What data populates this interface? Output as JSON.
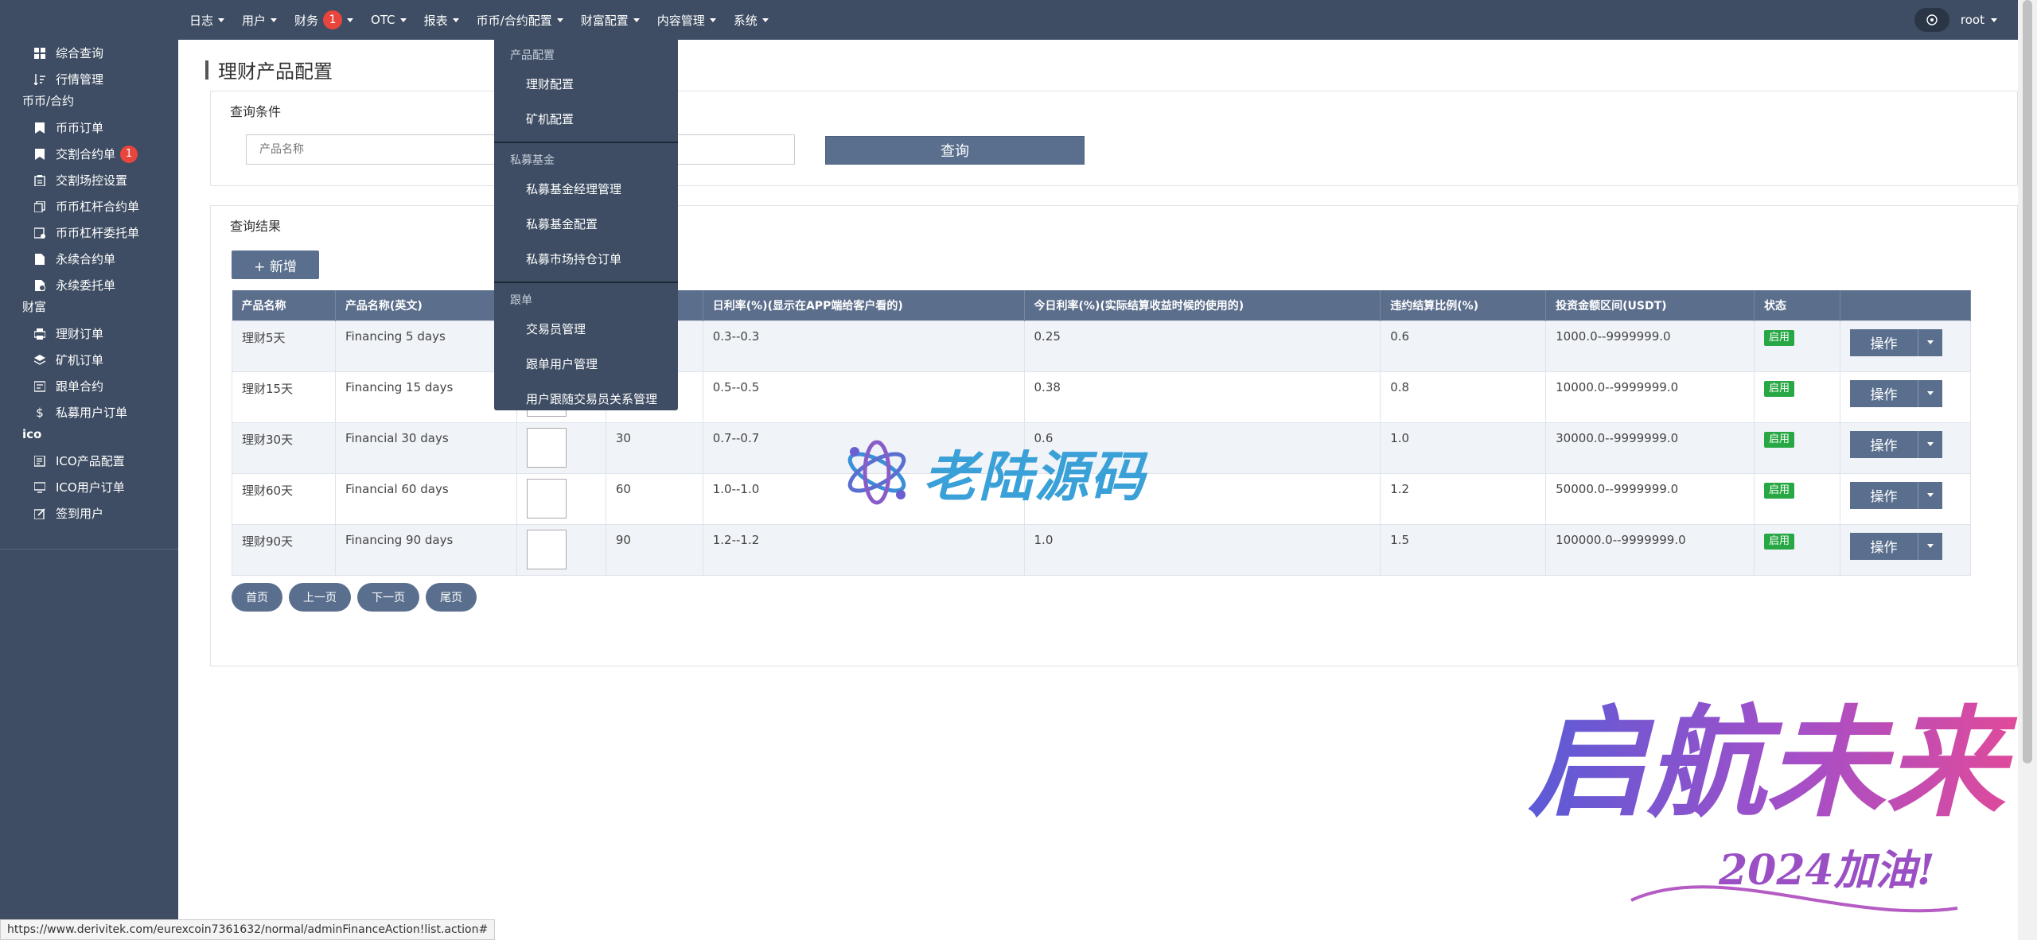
{
  "topnav": {
    "menu": [
      {
        "label": "日志",
        "badge": ""
      },
      {
        "label": "用户",
        "badge": ""
      },
      {
        "label": "财务",
        "badge": "1"
      },
      {
        "label": "OTC",
        "badge": ""
      },
      {
        "label": "报表",
        "badge": ""
      },
      {
        "label": "币币/合约配置",
        "badge": ""
      },
      {
        "label": "财富配置",
        "badge": ""
      },
      {
        "label": "内容管理",
        "badge": ""
      },
      {
        "label": "系统",
        "badge": ""
      }
    ],
    "user": "root"
  },
  "sidebar": {
    "top_items": [
      {
        "label": "综合查询",
        "icon": "dashboard-icon"
      },
      {
        "label": "行情管理",
        "icon": "sort-icon"
      }
    ],
    "group_coin": "币币/合约",
    "coin_items": [
      {
        "label": "币币订单",
        "icon": "bookmark-icon",
        "badge": ""
      },
      {
        "label": "交割合约单",
        "icon": "bookmark-icon",
        "badge": "1"
      },
      {
        "label": "交割场控设置",
        "icon": "clipboard-icon",
        "badge": ""
      },
      {
        "label": "币币杠杆合约单",
        "icon": "copy-icon",
        "badge": ""
      },
      {
        "label": "币币杠杆委托单",
        "icon": "calendar-icon",
        "badge": ""
      },
      {
        "label": "永续合约单",
        "icon": "file-icon",
        "badge": ""
      },
      {
        "label": "永续委托单",
        "icon": "file-clock-icon",
        "badge": ""
      }
    ],
    "group_wealth": "财富",
    "wealth_items": [
      {
        "label": "理财订单",
        "icon": "print-icon"
      },
      {
        "label": "矿机订单",
        "icon": "layers-icon"
      },
      {
        "label": "跟单合约",
        "icon": "archive-icon"
      },
      {
        "label": "私募用户订单",
        "icon": "dollar-icon"
      }
    ],
    "group_ico": "ico",
    "ico_items": [
      {
        "label": "ICO产品配置",
        "icon": "note-icon"
      },
      {
        "label": "ICO用户订单",
        "icon": "monitor-icon"
      },
      {
        "label": "签到用户",
        "icon": "edit-icon"
      }
    ]
  },
  "page": {
    "title": "理财产品配置",
    "query_title": "查询条件",
    "product_name_placeholder": "产品名称",
    "query_button": "查询",
    "result_title": "查询结果",
    "add_button": "+ 新增"
  },
  "table": {
    "headers": [
      "产品名称",
      "产品名称(英文)",
      "",
      "",
      "日利率(%)(显示在APP端给客户看的)",
      "今日利率(%)(实际结算收益时候的使用的)",
      "违约结算比例(%)",
      "投资金额区间(USDT)",
      "状态",
      ""
    ],
    "rows": [
      {
        "name": "理财5天",
        "name_en": "Financing 5 days",
        "days": "",
        "daily_rate": "0.3--0.3",
        "today_rate": "0.25",
        "penalty": "0.6",
        "range": "1000.0--9999999.0",
        "status": "启用",
        "op": "操作"
      },
      {
        "name": "理财15天",
        "name_en": "Financing 15 days",
        "days": "",
        "daily_rate": "0.5--0.5",
        "today_rate": "0.38",
        "penalty": "0.8",
        "range": "10000.0--9999999.0",
        "status": "启用",
        "op": "操作"
      },
      {
        "name": "理财30天",
        "name_en": "Financial 30 days",
        "days": "30",
        "daily_rate": "0.7--0.7",
        "today_rate": "0.6",
        "penalty": "1.0",
        "range": "30000.0--9999999.0",
        "status": "启用",
        "op": "操作"
      },
      {
        "name": "理财60天",
        "name_en": "Financial 60 days",
        "days": "60",
        "daily_rate": "1.0--1.0",
        "today_rate": "",
        "penalty": "1.2",
        "range": "50000.0--9999999.0",
        "status": "启用",
        "op": "操作"
      },
      {
        "name": "理财90天",
        "name_en": "Financing 90 days",
        "days": "90",
        "daily_rate": "1.2--1.2",
        "today_rate": "1.0",
        "penalty": "1.5",
        "range": "100000.0--9999999.0",
        "status": "启用",
        "op": "操作"
      }
    ]
  },
  "pager": [
    "首页",
    "上一页",
    "下一页",
    "尾页"
  ],
  "dropdown": {
    "h1": "产品配置",
    "g1": [
      "理财配置",
      "矿机配置"
    ],
    "h2": "私募基金",
    "g2": [
      "私募基金经理管理",
      "私募基金配置",
      "私募市场持仓订单"
    ],
    "h3": "跟单",
    "g3": [
      "交易员管理",
      "跟单用户管理",
      "用户跟随交易员关系管理"
    ]
  },
  "watermark": {
    "logo_text": "老陆源码",
    "art_text": "启航未来",
    "art_sub": "2024加油!"
  },
  "statusbar": "https://www.derivitek.com/eurexcoin7361632/normal/adminFinanceAction!list.action#"
}
